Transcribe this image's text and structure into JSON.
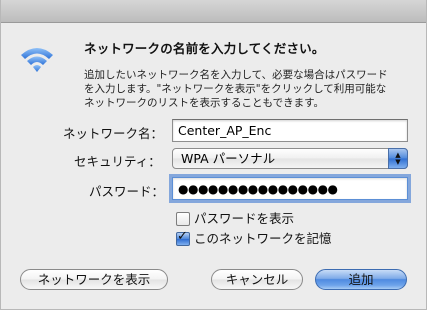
{
  "dialog": {
    "heading": "ネットワークの名前を入力してください。",
    "description_lines": [
      "追加したいネットワーク名を入力して、必要な場合はパスワード",
      "を入力します。\"ネットワークを表示\"をクリックして利用可能な",
      "ネットワークのリストを表示することもできます。"
    ]
  },
  "form": {
    "network_name_label": "ネットワーク名：",
    "network_name_value": "Center_AP_Enc",
    "security_label": "セキュリティ：",
    "security_value": "WPA パーソナル",
    "password_label": "パスワード：",
    "password_masked": "●●●●●●●●●●●●●●●●",
    "show_password_label": "パスワードを表示",
    "show_password_checked": false,
    "remember_network_label": "このネットワークを記憶",
    "remember_network_checked": true
  },
  "buttons": {
    "show_networks": "ネットワークを表示",
    "cancel": "キャンセル",
    "add": "追加"
  },
  "icons": {
    "wifi": "wifi-icon",
    "popup_arrows": "up-down-arrows-icon",
    "checkmark": "checkmark-icon"
  },
  "colors": {
    "accent_blue": "#4e8ae0",
    "wifi_blue": "#4d8ee8"
  }
}
